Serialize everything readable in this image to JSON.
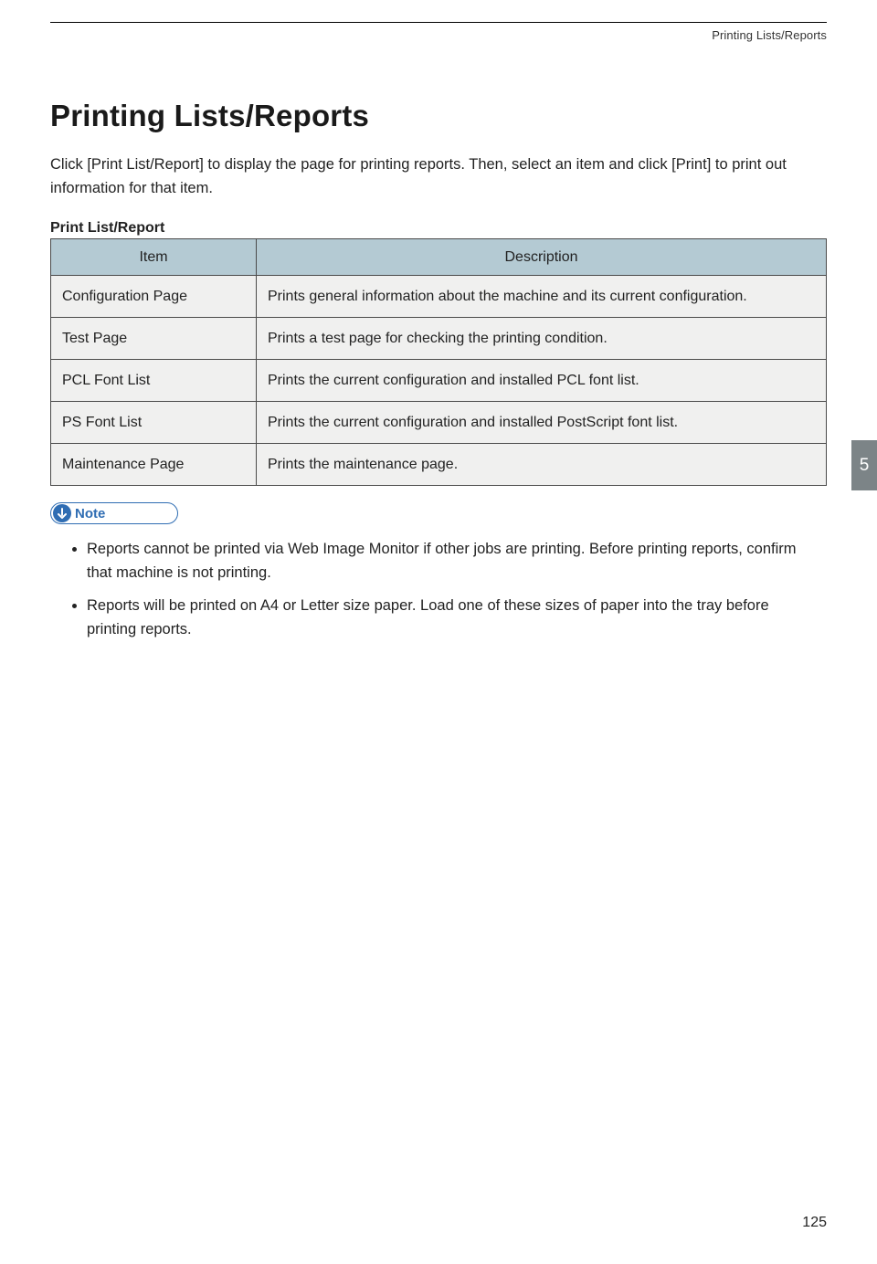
{
  "header": {
    "running_head": "Printing Lists/Reports"
  },
  "title": "Printing Lists/Reports",
  "intro": "Click [Print List/Report] to display the page for printing reports. Then, select an item and click [Print] to print out information for that item.",
  "section_label": "Print List/Report",
  "table": {
    "headers": {
      "item": "Item",
      "description": "Description"
    },
    "rows": [
      {
        "item": "Configuration Page",
        "desc": "Prints general information about the machine and its current configuration."
      },
      {
        "item": "Test Page",
        "desc": "Prints a test page for checking the printing condition."
      },
      {
        "item": "PCL Font List",
        "desc": "Prints the current configuration and installed PCL font list."
      },
      {
        "item": "PS Font List",
        "desc": "Prints the current configuration and installed PostScript font list."
      },
      {
        "item": "Maintenance Page",
        "desc": "Prints the maintenance page."
      }
    ]
  },
  "note": {
    "label": "Note",
    "items": [
      "Reports cannot be printed via Web Image Monitor if other jobs are printing. Before printing reports, confirm that machine is not printing.",
      "Reports will be printed on A4 or Letter size paper. Load one of these sizes of paper into the tray before printing reports."
    ]
  },
  "side_tab": "5",
  "page_number": "125"
}
